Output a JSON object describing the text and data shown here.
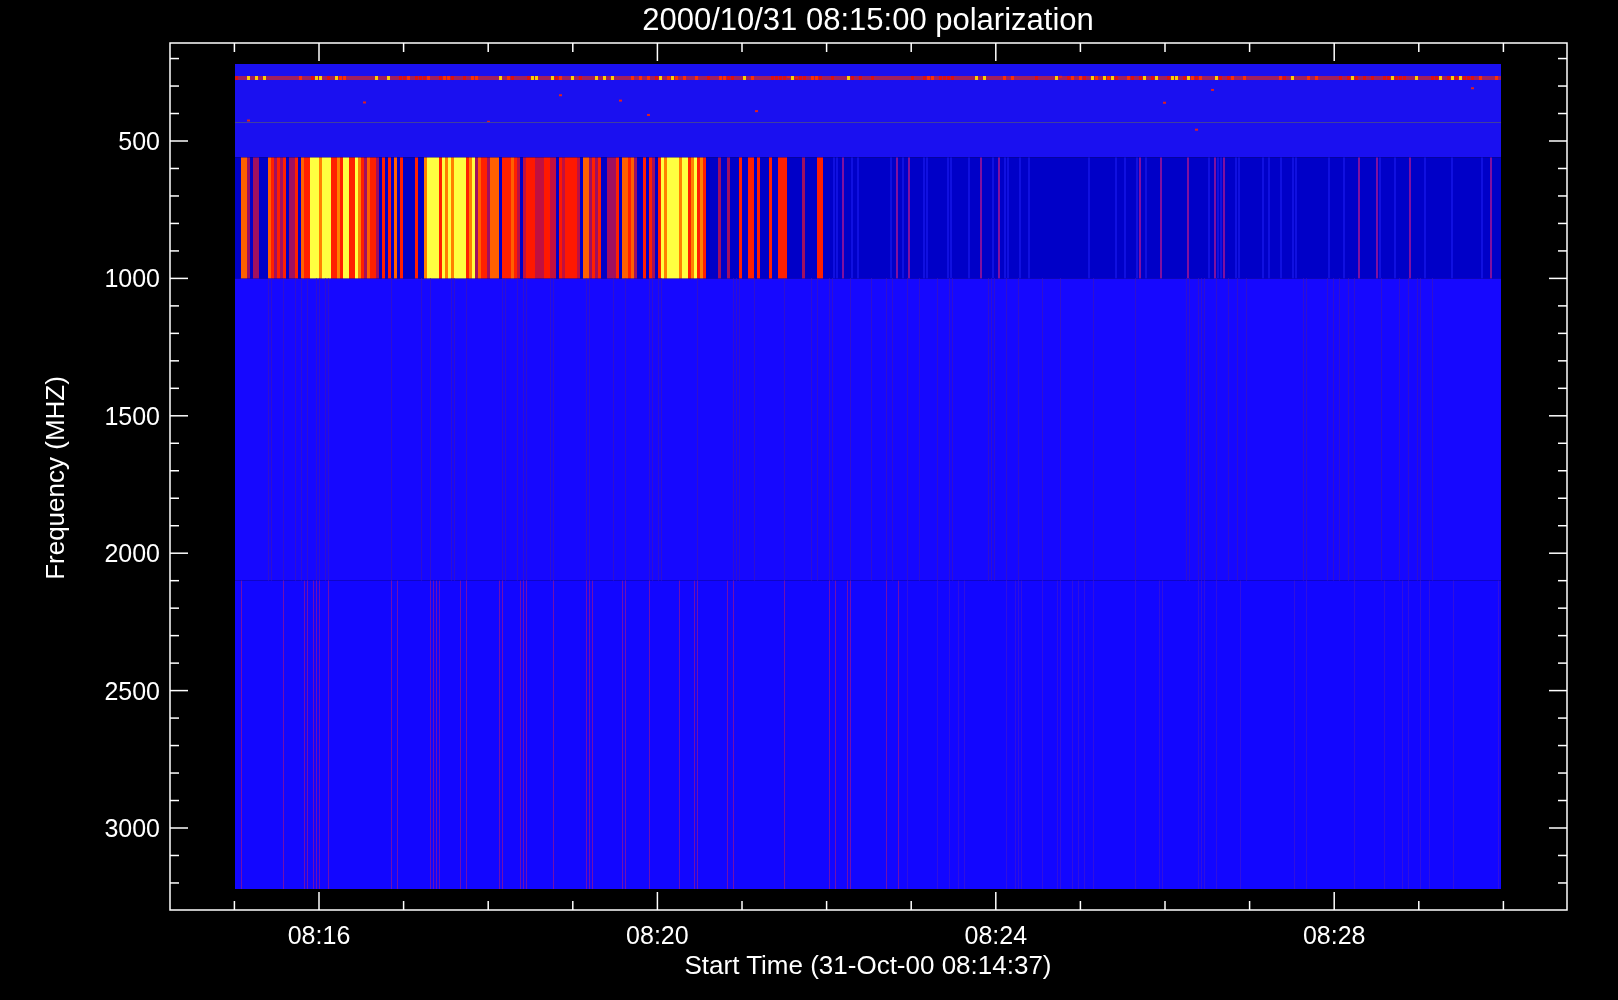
{
  "title": "2000/10/31 08:15:00 polarization",
  "ylabel": "Frequency (MHZ)",
  "xlabel": "Start Time (31-Oct-00 08:14:37)",
  "y_tick_labels": [
    "500",
    "1000",
    "1500",
    "2000",
    "2500",
    "3000"
  ],
  "x_tick_labels": [
    "08:16",
    "08:20",
    "08:24",
    "08:28"
  ]
}
